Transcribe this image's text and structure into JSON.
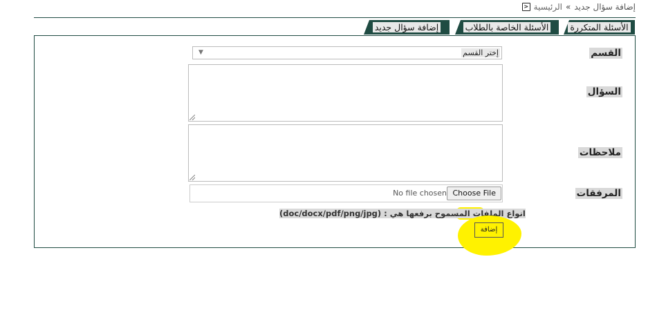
{
  "breadcrumb": {
    "home": "الرئيسية",
    "separator": "»",
    "current": "إضافة سؤال جديد"
  },
  "tabs": {
    "faq": "الأسئلة المتكررة",
    "students": "الأسئلة الخاصة بالطلاب",
    "new_question": "إضافة سؤال جديد"
  },
  "form": {
    "category_label": "القسم",
    "category_value": "إختر القسم",
    "question_label": "السؤال",
    "notes_label": "ملاحظات",
    "attachments_label": "المرفقات",
    "file_button": "Choose File",
    "file_status": "No file chosen",
    "allowed_types": "انواع الملفات المسموح برفعها هي : (doc/docx/pdf/png/jpg)",
    "submit": "إضافة"
  },
  "colors": {
    "tab_bg": "#1f4b42",
    "highlight": "#fff200",
    "label_bg": "#d9d9d9"
  }
}
